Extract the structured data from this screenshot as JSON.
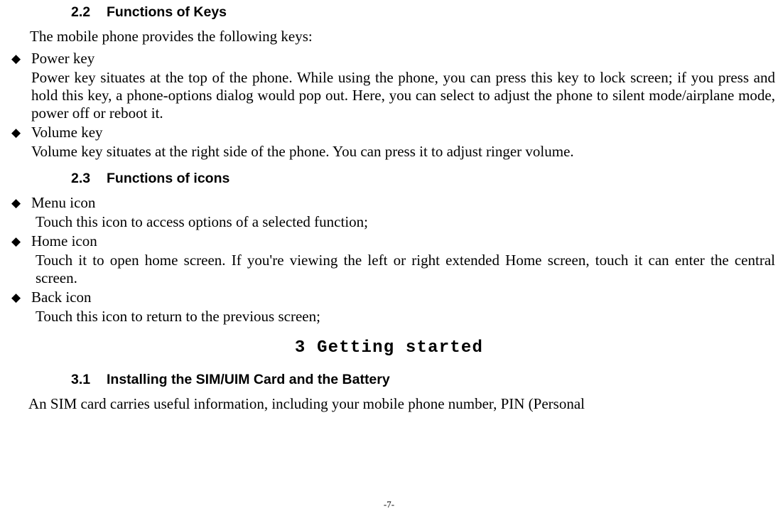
{
  "sections": {
    "s22": {
      "num": "2.2",
      "title": "Functions of Keys"
    },
    "s23": {
      "num": "2.3",
      "title": "Functions of icons"
    },
    "s31": {
      "num": "3.1",
      "title": "Installing the SIM/UIM Card and the Battery"
    }
  },
  "intro_keys": "The mobile phone provides the following keys:",
  "keys": {
    "power": {
      "title": "Power key",
      "desc": "Power key situates at the top of the phone. While using the phone, you can press this key to lock screen; if you press and hold this key, a phone-options dialog would pop out. Here, you can select to adjust the phone to silent mode/airplane mode, power off or reboot it."
    },
    "volume": {
      "title": "Volume key",
      "desc": "Volume key situates at the right side of the phone. You can press it to adjust ringer volume."
    }
  },
  "icons": {
    "menu": {
      "title": "Menu icon",
      "desc": "Touch this icon to access options of a selected function;"
    },
    "home": {
      "title": "Home icon",
      "desc": "Touch it to open home screen. If you're viewing the left or right extended Home screen, touch it can enter the central screen."
    },
    "back": {
      "title": "Back icon",
      "desc": "Touch this icon to return to the previous screen;"
    }
  },
  "chapter3": "3 Getting started",
  "sim_para": "An SIM card carries useful information, including your mobile phone number, PIN (Personal",
  "page_number": "-7-"
}
